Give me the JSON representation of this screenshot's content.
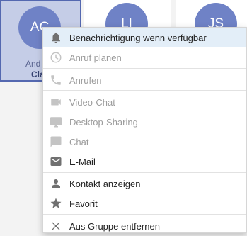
{
  "cards": [
    {
      "initials": "AC",
      "line1": "And",
      "line2": "Cla"
    },
    {
      "initials": "LI"
    },
    {
      "initials": "JS"
    }
  ],
  "menu": {
    "items": [
      {
        "label": "Benachrichtigung wenn verfügbar",
        "icon": "bell-icon",
        "enabled": true,
        "highlighted": true
      },
      {
        "label": "Anruf planen",
        "icon": "clock-icon",
        "enabled": false
      },
      {
        "label": "Anrufen",
        "icon": "phone-icon",
        "enabled": false
      },
      {
        "label": "Video-Chat",
        "icon": "video-camera-icon",
        "enabled": false
      },
      {
        "label": "Desktop-Sharing",
        "icon": "monitor-icon",
        "enabled": false
      },
      {
        "label": "Chat",
        "icon": "chat-bubble-icon",
        "enabled": false
      },
      {
        "label": "E-Mail",
        "icon": "envelope-icon",
        "enabled": true
      },
      {
        "label": "Kontakt anzeigen",
        "icon": "person-icon",
        "enabled": true
      },
      {
        "label": "Favorit",
        "icon": "star-icon",
        "enabled": true
      },
      {
        "label": "Aus Gruppe entfernen",
        "icon": "close-icon",
        "enabled": true
      }
    ]
  },
  "colors": {
    "avatar": "#6f82c6",
    "selected_card": "#c5cde7",
    "selected_border": "#5468b0",
    "highlight": "#e3eef8",
    "enabled_icon": "#707070",
    "disabled_icon": "#c4c4c4"
  }
}
